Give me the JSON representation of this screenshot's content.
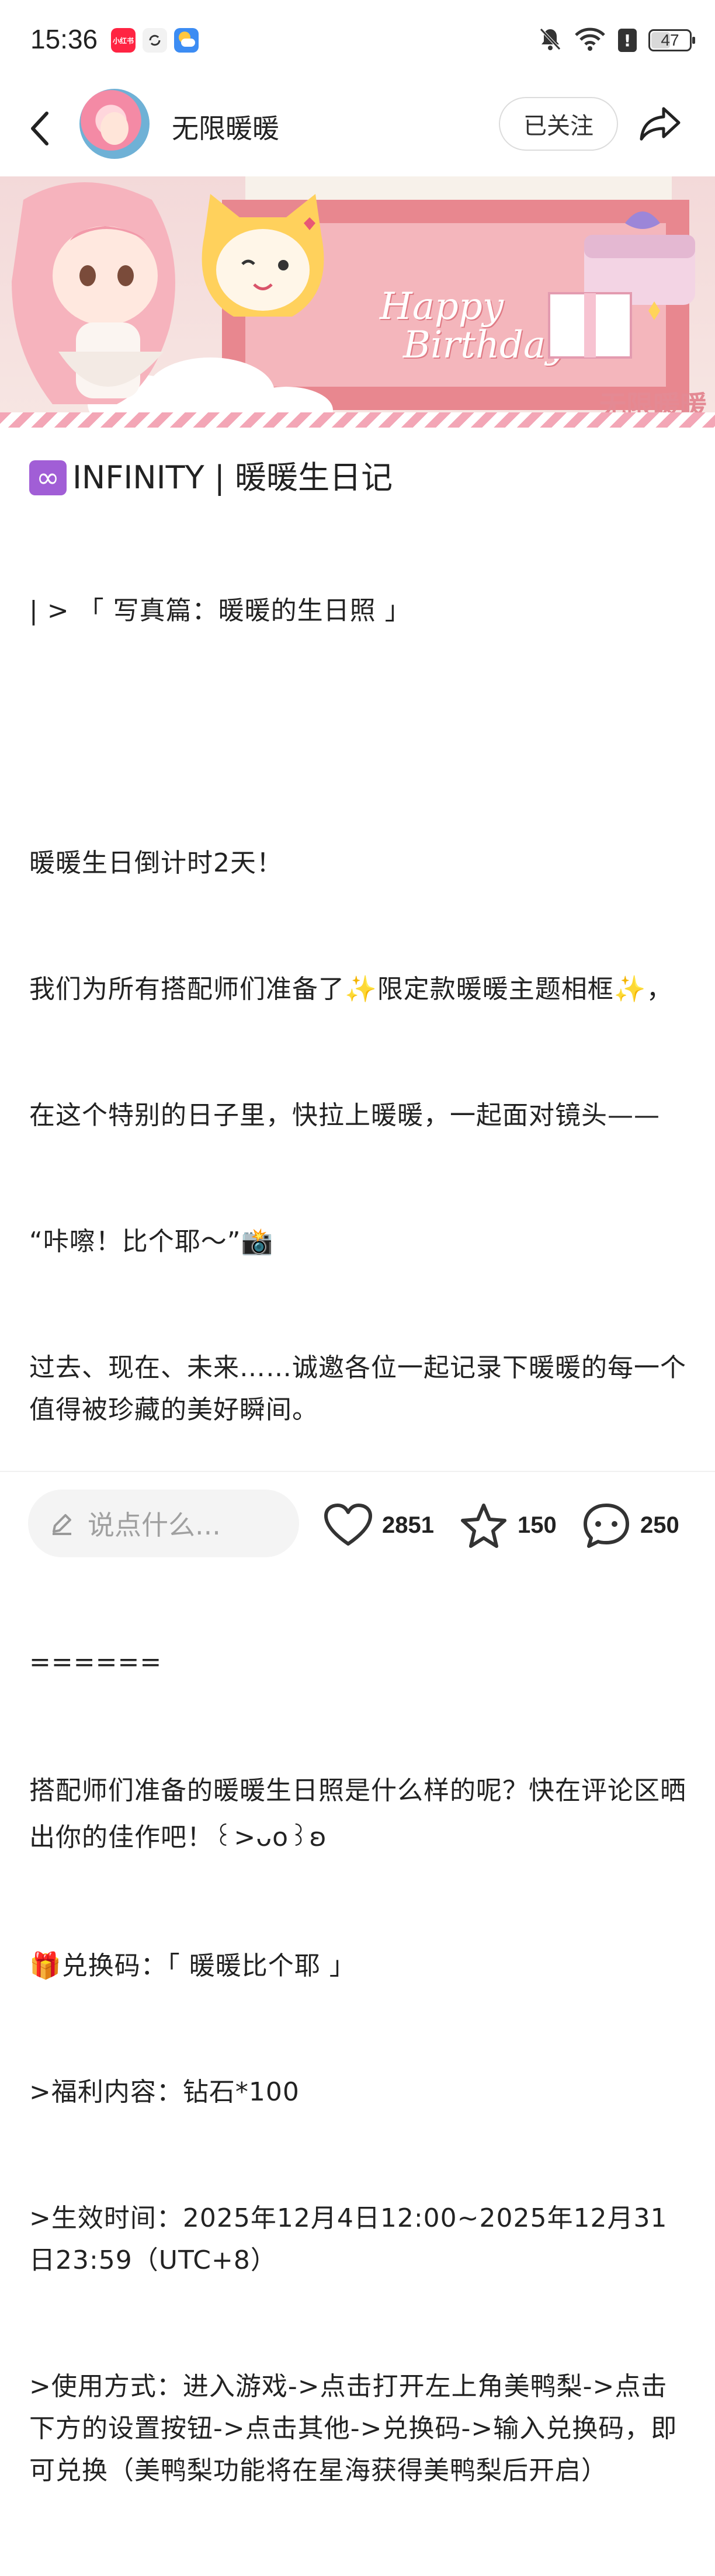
{
  "status_bar": {
    "time": "15:36",
    "app_icon_label": "小红书",
    "battery": "47"
  },
  "header": {
    "account_name": "无限暖暖",
    "follow_label": "已关注"
  },
  "banner": {
    "text_line1": "Happy",
    "text_line2": "Birthday",
    "watermark": "无限暖暖"
  },
  "post": {
    "title_icon": "∞",
    "title": "INFINITY | 暖暖生日记",
    "subtitle": "| > 「 写真篇：暖暖的生日照 」",
    "p1": "暖暖生日倒计时2天！",
    "p2": "我们为所有搭配师们准备了✨限定款暖暖主题相框✨，",
    "p3": "在这个特别的日子里，快拉上暖暖，一起面对镜头——",
    "p4": "“咔嚓！比个耶～”📸",
    "p5": "过去、现在、未来……诚邀各位一起记录下暖暖的每一个值得被珍藏的美好瞬间。",
    "divider": "======",
    "p6": "搭配师们准备的暖暖生日照是什么样的呢？快在评论区晒出你的佳作吧！꒰>ᴗo꒱ʚ",
    "p7": "🎁兑换码：「 暖暖比个耶 」",
    "p8": ">福利内容：钻石*100",
    "p9": ">生效时间：2025年12月4日12:00~2025年12月31日23:59（UTC+8）",
    "p10": ">使用方式：进入游戏->点击打开左上角美鸭梨->点击下方的设置按钮->点击其他->兑换码->输入兑换码，即可兑换（美鸭梨功能将在星海获得美鸭梨后开启）"
  },
  "bottom_bar": {
    "comment_placeholder": "说点什么...",
    "like_count": "2851",
    "fav_count": "150",
    "comment_count": "250"
  },
  "colors": {
    "accent_pink": "#ff2442",
    "infinity_badge": "#a15ed6"
  }
}
